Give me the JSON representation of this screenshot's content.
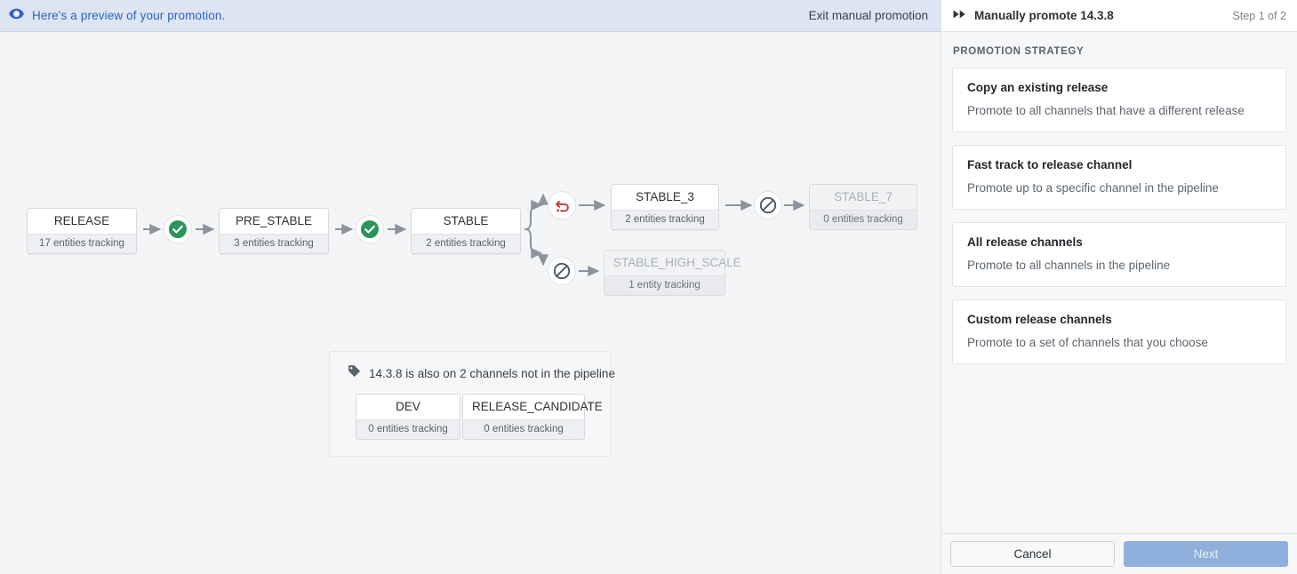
{
  "banner": {
    "icon": "eye-icon",
    "message": "Here's a preview of your promotion.",
    "exit_label": "Exit manual promotion"
  },
  "panel": {
    "icon": "fast-forward-icon",
    "title": "Manually promote 14.3.8",
    "step": "Step 1 of 2",
    "section_label": "PROMOTION STRATEGY",
    "options": [
      {
        "title": "Copy an existing release",
        "description": "Promote to all channels that have a different release"
      },
      {
        "title": "Fast track to release channel",
        "description": "Promote up to a specific channel in the pipeline"
      },
      {
        "title": "All release channels",
        "description": "Promote to all channels in the pipeline"
      },
      {
        "title": "Custom release channels",
        "description": "Promote to a set of channels that you choose"
      }
    ],
    "cancel_label": "Cancel",
    "next_label": "Next"
  },
  "pipeline": {
    "nodes": [
      {
        "name": "RELEASE",
        "sub": "17 entities tracking",
        "disabled": false
      },
      {
        "name": "PRE_STABLE",
        "sub": "3 entities tracking",
        "disabled": false
      },
      {
        "name": "STABLE",
        "sub": "2 entities tracking",
        "disabled": false
      },
      {
        "name": "STABLE_3",
        "sub": "2 entities tracking",
        "disabled": false
      },
      {
        "name": "STABLE_7",
        "sub": "0 entities tracking",
        "disabled": true
      },
      {
        "name": "STABLE_HIGH_SCALE",
        "sub": "1 entity tracking",
        "disabled": true
      }
    ],
    "status_icons": [
      {
        "id": "promote-ok-1",
        "kind": "check-circle-icon"
      },
      {
        "id": "promote-ok-2",
        "kind": "check-circle-icon"
      },
      {
        "id": "rollback-1",
        "kind": "rollback-icon"
      },
      {
        "id": "blocked-1",
        "kind": "blocked-icon"
      },
      {
        "id": "blocked-2",
        "kind": "blocked-icon"
      }
    ],
    "colors": {
      "success": "#2a9358",
      "rollback": "#c93a3a",
      "blocked": "#4c5864",
      "arrow": "#8b949e"
    }
  },
  "off_pipeline": {
    "icon": "tag-icon",
    "heading": "14.3.8 is also on 2 channels not in the pipeline",
    "nodes": [
      {
        "name": "DEV",
        "sub": "0 entities tracking"
      },
      {
        "name": "RELEASE_CANDIDATE",
        "sub": "0 entities tracking"
      }
    ]
  }
}
